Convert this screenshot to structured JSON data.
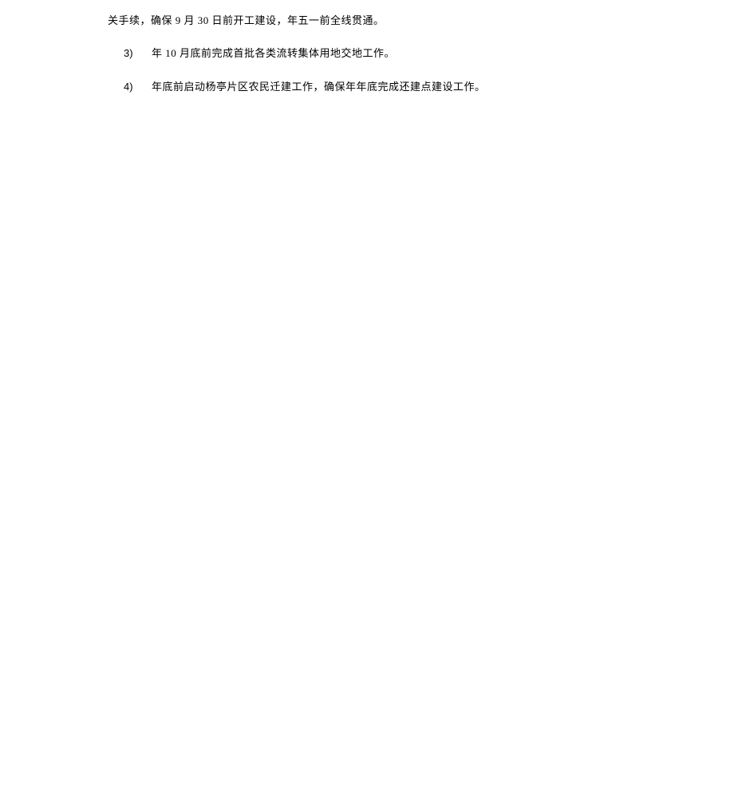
{
  "continuation": "关手续，确保 9 月 30 日前开工建设，年五一前全线贯通。",
  "items": [
    {
      "marker": "3)",
      "text": "年 10 月底前完成首批各类流转集体用地交地工作。"
    },
    {
      "marker": "4)",
      "text": "年底前启动杨亭片区农民迁建工作，确保年年底完成还建点建设工作。"
    }
  ]
}
